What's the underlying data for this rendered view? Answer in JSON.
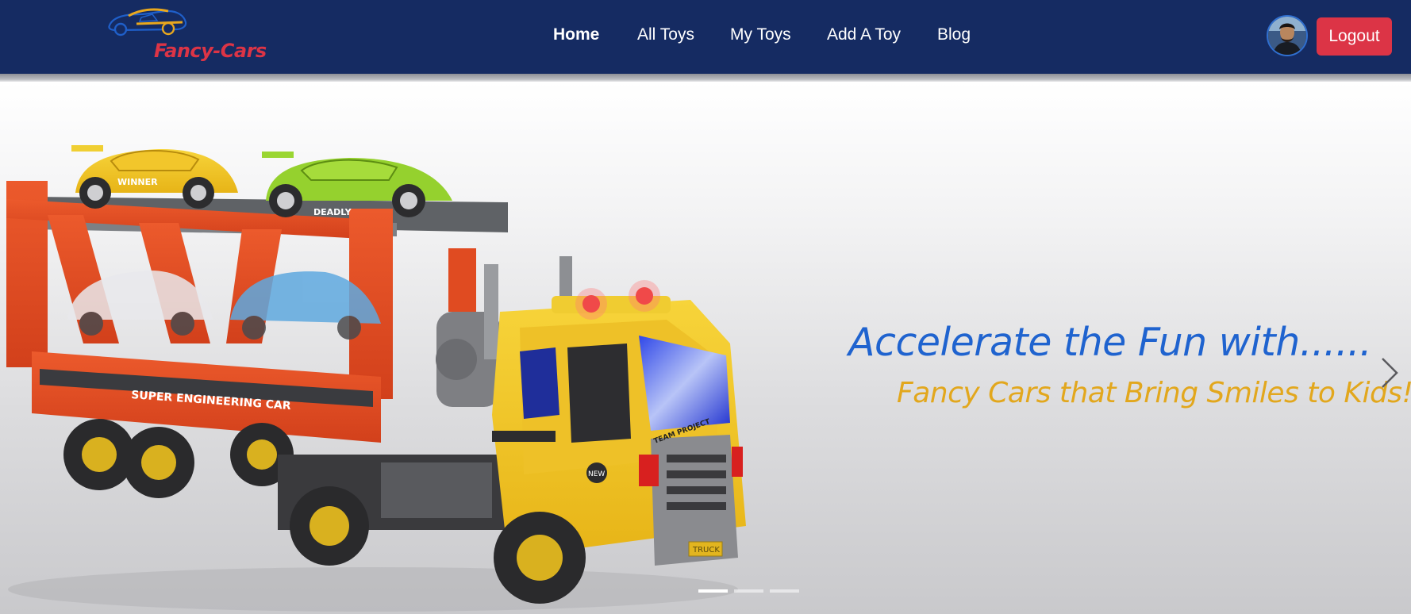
{
  "navbar": {
    "brand_name": "Fancy-Cars",
    "links": [
      {
        "label": "Home",
        "active": true
      },
      {
        "label": "All Toys",
        "active": false
      },
      {
        "label": "My Toys",
        "active": false
      },
      {
        "label": "Add A Toy",
        "active": false
      },
      {
        "label": "Blog",
        "active": false
      }
    ],
    "logout_label": "Logout",
    "colors": {
      "background": "#152b62",
      "brand": "#dc3446",
      "logout": "#dc3446"
    }
  },
  "hero": {
    "headline": "Accelerate the Fun with......",
    "subline": "Fancy Cars that Bring Smiles to Kids!",
    "image_text": {
      "truck_side": "SUPER ENGINEERING CAR",
      "car_left": "WINNER",
      "car_right": "DEADLY",
      "grille": "TEAM PROJECT",
      "badge": "NEW",
      "plate": "TRUCK"
    },
    "next_icon": "chevron-right-icon",
    "colors": {
      "headline": "#1f63cf",
      "subline": "#e2a71d"
    }
  },
  "carousel": {
    "slide_count": 3,
    "active_index": 0
  }
}
